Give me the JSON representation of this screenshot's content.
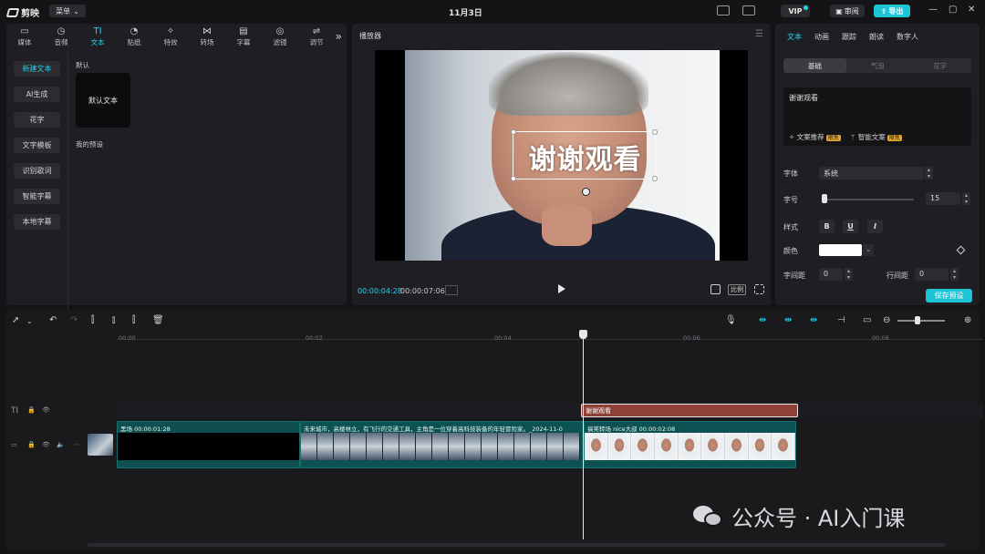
{
  "titlebar": {
    "app_name": "剪映",
    "menu_label": "菜单",
    "project_title": "11月3日",
    "vip_label": "VIP",
    "review_label": "审阅",
    "export_label": "导出"
  },
  "media_panel": {
    "tabs": [
      {
        "label": "媒体",
        "icon": "▭"
      },
      {
        "label": "音频",
        "icon": "◷"
      },
      {
        "label": "文本",
        "icon": "TI"
      },
      {
        "label": "贴纸",
        "icon": "◔"
      },
      {
        "label": "特效",
        "icon": "✧"
      },
      {
        "label": "转场",
        "icon": "⋈"
      },
      {
        "label": "字幕",
        "icon": "▤"
      },
      {
        "label": "滤镜",
        "icon": "◎"
      },
      {
        "label": "调节",
        "icon": "⇌"
      }
    ],
    "sidebar": [
      "新建文本",
      "AI生成",
      "花字",
      "文字模板",
      "识别歌词",
      "智能字幕",
      "本地字幕"
    ],
    "default_section": "默认",
    "default_card": "默认文本",
    "my_presets_section": "我的预设"
  },
  "player": {
    "title": "播放器",
    "overlay_text": "谢谢观看",
    "current_time": "00:00:04:28",
    "total_time": "00:00:07:06",
    "ratio_label": "比例"
  },
  "properties": {
    "tabs": [
      "文本",
      "动画",
      "跟踪",
      "朗读",
      "数字人"
    ],
    "segments": [
      "基础",
      "气泡",
      "花字"
    ],
    "text_value": "谢谢观看",
    "action_recommend": "文案推荐",
    "action_smart": "智能文案",
    "badge": "限免",
    "font_label": "字体",
    "font_value": "系统",
    "size_label": "字号",
    "size_value": "15",
    "size_fraction": 0.02,
    "style_label": "样式",
    "style_buttons": [
      "B",
      "U",
      "I"
    ],
    "color_label": "颜色",
    "color_value": "#FFFFFF",
    "char_spacing_label": "字间距",
    "char_spacing_value": "0",
    "line_spacing_label": "行间距",
    "line_spacing_value": "0",
    "save_preset": "保存预设"
  },
  "timeline": {
    "ruler_ticks": [
      "00:00",
      "00:02",
      "00:04",
      "00:06",
      "00:08"
    ],
    "text_clip": "谢谢观看",
    "clips": [
      {
        "label": "黑场  00:00:01:28"
      },
      {
        "label": "未来城市，高楼林立，有飞行的交通工具，主角是一位穿着高科技装备的年轻冒险家。_2024-11-0"
      },
      {
        "label": "搞笑转场 nice大叔  00:00:02:08"
      }
    ]
  },
  "watermark": "公众号 · AI入门课",
  "colors": {
    "accent": "#22d3ee",
    "export": "#1fc3d6",
    "text_clip": "#8e4134",
    "video_track": "#0d5252"
  }
}
